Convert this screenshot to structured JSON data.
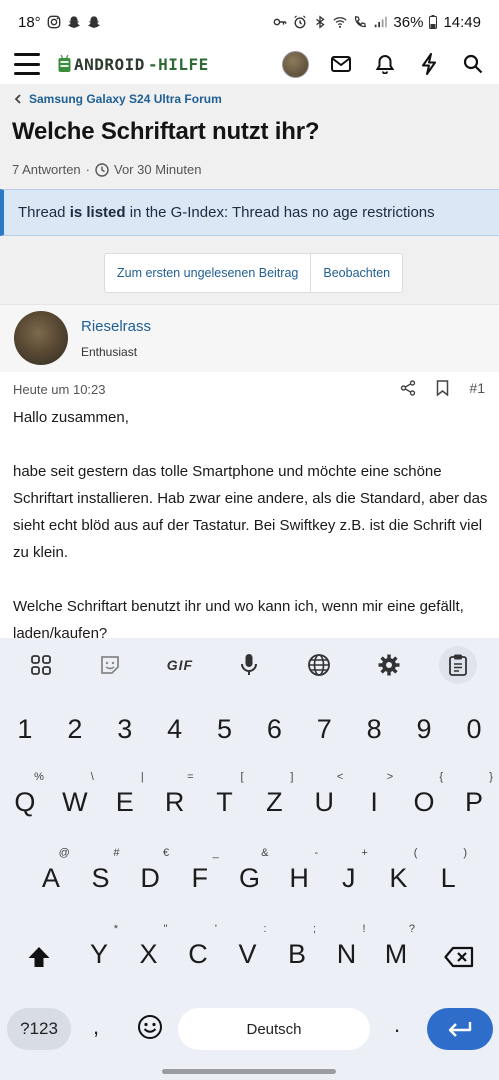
{
  "status_bar": {
    "temperature": "18°",
    "battery": "36%",
    "time": "14:49"
  },
  "header": {
    "logo_text_left": "ANDROID",
    "logo_text_right": "-HILFE"
  },
  "thread": {
    "breadcrumb": "Samsung Galaxy S24 Ultra Forum",
    "title": "Welche Schriftart nutzt ihr?",
    "replies": "7 Antworten",
    "separator": "·",
    "time_ago": "Vor 30 Minuten",
    "notice_prefix": "Thread ",
    "notice_bold": "is listed",
    "notice_suffix": " in the G-Index: Thread has no age restrictions",
    "btn_first_unread": "Zum ersten ungelesenen Beitrag",
    "btn_watch": "Beobachten"
  },
  "post": {
    "author": "Rieselrass",
    "role": "Enthusiast",
    "date": "Heute um 10:23",
    "number": "#1",
    "p1": "Hallo zusammen,",
    "p2": "habe seit gestern das tolle Smartphone und möchte eine schöne Schriftart installieren. Hab zwar eine andere, als die Standard, aber das sieht echt blöd aus auf der Tastatur. Bei Swiftkey z.B. ist die Schrift viel zu klein.",
    "p3": "Welche Schriftart benutzt ihr und wo kann ich, wenn mir eine gefällt, laden/kaufen?"
  },
  "keyboard": {
    "toolbar_gif": "GIF",
    "numbers": [
      "1",
      "2",
      "3",
      "4",
      "5",
      "6",
      "7",
      "8",
      "9",
      "0"
    ],
    "row1": [
      [
        "Q",
        "%"
      ],
      [
        "W",
        "\\"
      ],
      [
        "E",
        "|"
      ],
      [
        "R",
        "="
      ],
      [
        "T",
        "["
      ],
      [
        "Z",
        "]"
      ],
      [
        "U",
        "<"
      ],
      [
        "I",
        ">"
      ],
      [
        "O",
        "{"
      ],
      [
        "P",
        "}"
      ]
    ],
    "row2": [
      [
        "A",
        "@"
      ],
      [
        "S",
        "#"
      ],
      [
        "D",
        "€"
      ],
      [
        "F",
        "_"
      ],
      [
        "G",
        "&"
      ],
      [
        "H",
        "-"
      ],
      [
        "J",
        "+"
      ],
      [
        "K",
        "("
      ],
      [
        "L",
        ")"
      ]
    ],
    "row3": [
      [
        "Y",
        "*"
      ],
      [
        "X",
        "\""
      ],
      [
        "C",
        "'"
      ],
      [
        "V",
        ":"
      ],
      [
        "B",
        ";"
      ],
      [
        "N",
        "!"
      ],
      [
        "M",
        "?"
      ]
    ],
    "mode_key": "?123",
    "comma": ",",
    "space_label": "Deutsch",
    "period": "."
  },
  "colors": {
    "link": "#1f5f94",
    "notice_bg": "#dce7f5",
    "notice_border": "#2b79c2",
    "keyboard_bg": "#eceff6",
    "enter_key": "#2f6dcb",
    "logo_green": "#2e6b34"
  }
}
